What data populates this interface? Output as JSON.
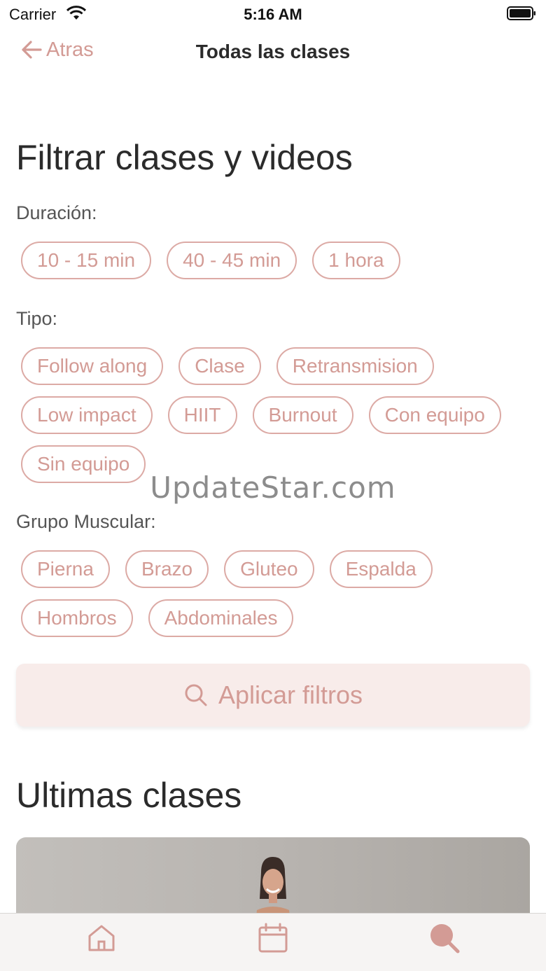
{
  "status_bar": {
    "carrier": "Carrier",
    "time": "5:16 AM",
    "icons": [
      "wifi-icon",
      "battery-icon"
    ]
  },
  "nav": {
    "back_label": "Atras",
    "title": "Todas las clases"
  },
  "filters": {
    "title": "Filtrar clases y videos",
    "duration": {
      "label": "Duración:",
      "options": [
        "10 - 15 min",
        "40 - 45 min",
        "1 hora"
      ]
    },
    "type": {
      "label": "Tipo:",
      "options": [
        "Follow along",
        "Clase",
        "Retransmision",
        "Low impact",
        "HIIT",
        "Burnout",
        "Con equipo",
        "Sin equipo"
      ]
    },
    "muscle_group": {
      "label": "Grupo Muscular:",
      "options": [
        "Pierna",
        "Brazo",
        "Gluteo",
        "Espalda",
        "Hombros",
        "Abdominales"
      ]
    },
    "apply_label": "Aplicar filtros"
  },
  "latest": {
    "title": "Ultimas clases"
  },
  "watermark": "UpdateStar.com",
  "tab_bar": {
    "tabs": [
      "home-icon",
      "calendar-icon",
      "search-icon"
    ]
  },
  "colors": {
    "accent": "#d39b95",
    "chip_border": "#dcaaa5",
    "button_bg": "#f8ecea"
  }
}
